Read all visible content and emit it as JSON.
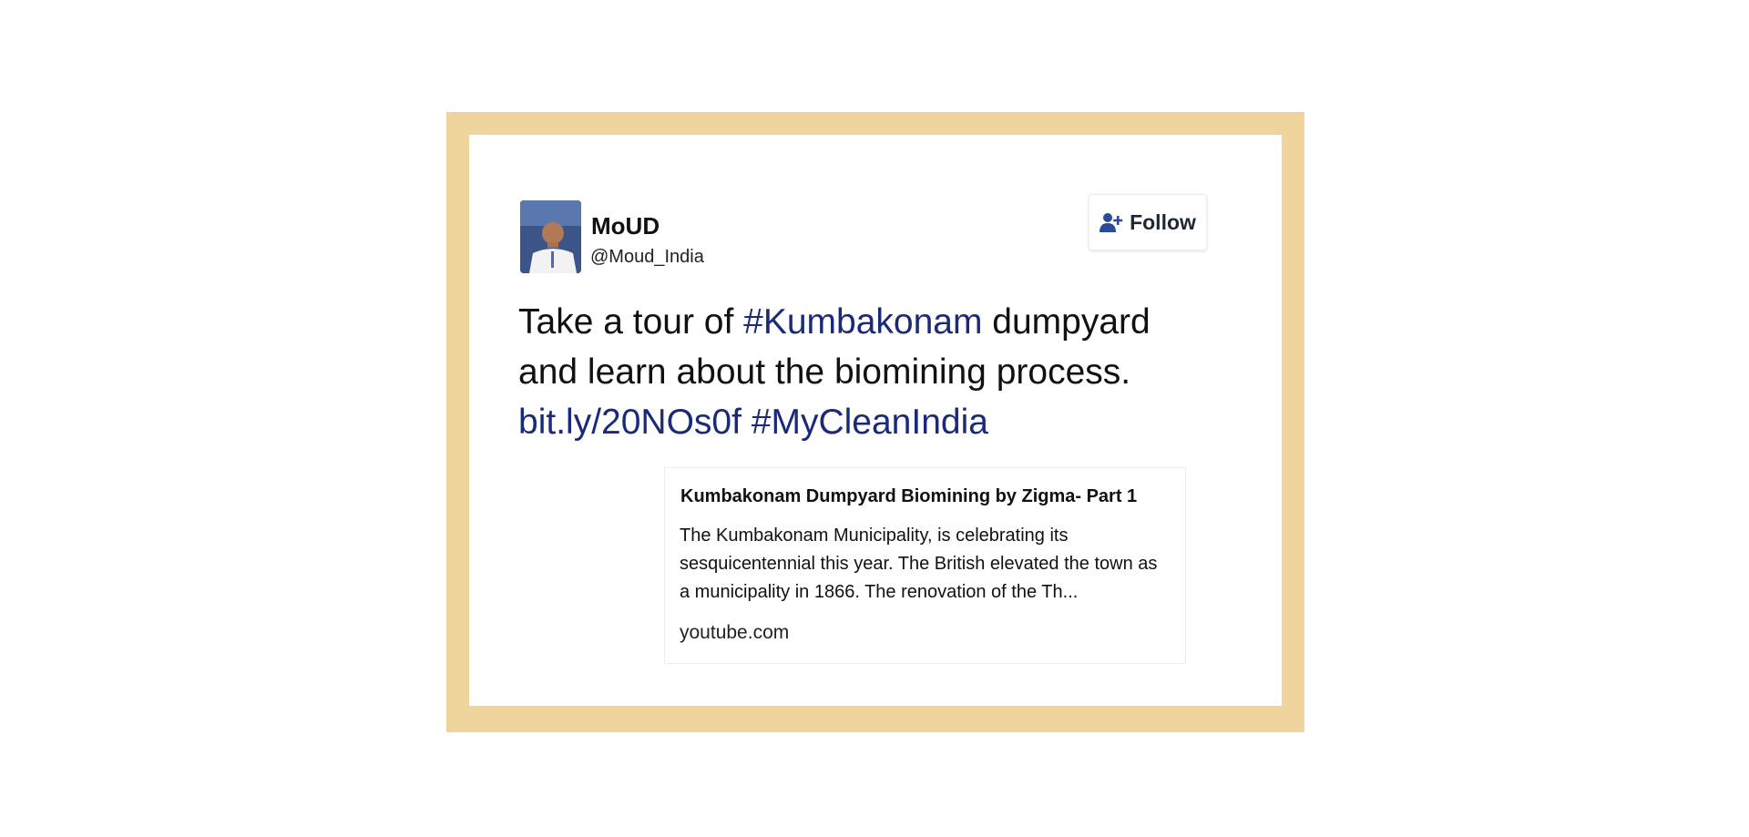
{
  "tweet": {
    "display_name": "MoUD",
    "handle": "@Moud_India",
    "follow_label": "Follow",
    "text_segments": [
      {
        "text": "Take a tour of ",
        "type": "text"
      },
      {
        "text": "#Kumbakonam",
        "type": "hashtag"
      },
      {
        "text": " dumpyard and learn about the biomining process. ",
        "type": "text"
      },
      {
        "text": "bit.ly/20NOs0f",
        "type": "link"
      },
      {
        "text": " ",
        "type": "text"
      },
      {
        "text": "#MyCleanIndia",
        "type": "hashtag"
      }
    ]
  },
  "preview_card": {
    "title": "Kumbakonam Dumpyard Biomining by Zigma- Part 1",
    "description": "The Kumbakonam Municipality, is celebrating its sesquicentennial this year. The British elevated the town as a municipality in 1866. The renovation of the Th...",
    "domain": "youtube.com"
  },
  "icons": {
    "follow": "add-user-icon",
    "avatar": "profile-photo"
  },
  "colors": {
    "frame": "#efd59b",
    "link": "#1a2a7a",
    "follow_icon": "#2a4a9a"
  }
}
